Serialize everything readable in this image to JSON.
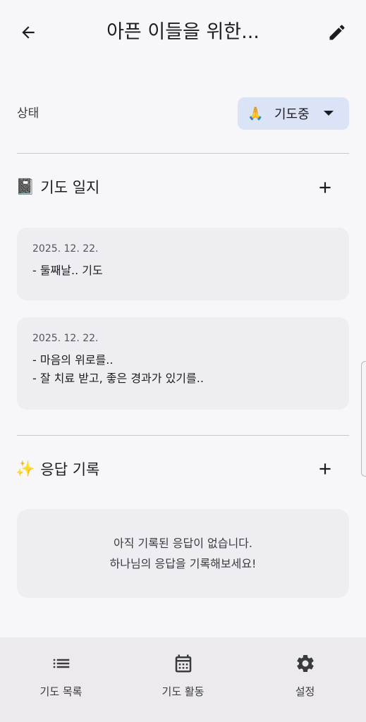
{
  "appbar": {
    "title": "아픈 이들을 위한..."
  },
  "status": {
    "label": "상태",
    "emoji": "🙏",
    "value": "기도중"
  },
  "journal": {
    "emoji": "📓",
    "title": "기도 일지",
    "entries": [
      {
        "date": "2025. 12. 22.",
        "lines": [
          "- 둘째날.. 기도"
        ]
      },
      {
        "date": "2025. 12. 22.",
        "lines": [
          "- 마음의 위로를..",
          "- 잘 치료 받고, 좋은 경과가 있기를.."
        ]
      }
    ]
  },
  "answers": {
    "emoji": "✨",
    "title": "응답 기록",
    "empty_line1": "아직 기록된 응답이 없습니다.",
    "empty_line2": "하나님의 응답을 기록해보세요!"
  },
  "nav": [
    {
      "label": "기도 목록",
      "icon": "list-icon"
    },
    {
      "label": "기도 활동",
      "icon": "calendar-icon"
    },
    {
      "label": "설정",
      "icon": "gear-icon"
    }
  ],
  "colors": {
    "accent_chip": "#dbe3f7",
    "card": "#eeedf2",
    "nav_bg": "#eceaef"
  }
}
